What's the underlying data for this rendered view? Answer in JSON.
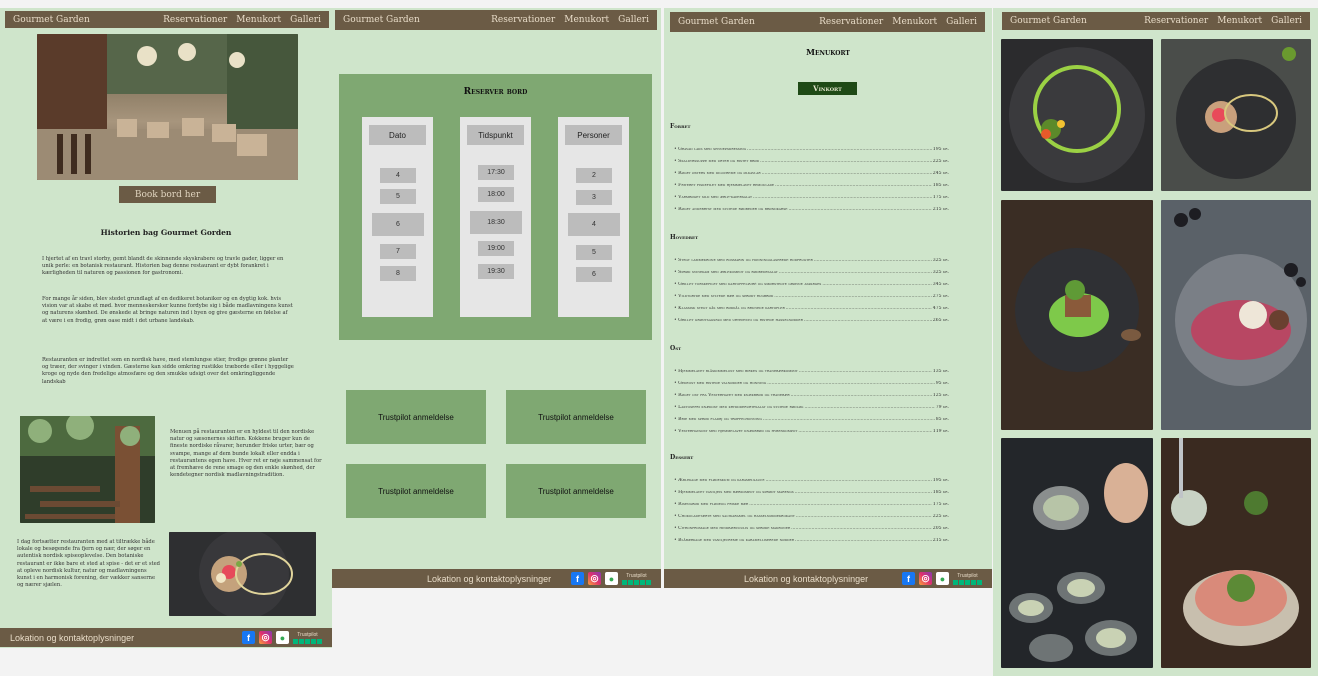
{
  "nav": {
    "brand": "Gourmet Garden",
    "links": [
      "Reservationer",
      "Menukort",
      "Galleri"
    ]
  },
  "home": {
    "book_button": "Book bord her",
    "history_title": "Historien bag Gourmet Gorden",
    "p1": "I hjertet af en travl storby, gemt blandt de skinnende skyskrabere og travle gader, ligger en unik perle: en botanisk restaurant. Historien bag denne restaurant er dybt forankret i kærligheden til naturen og passionen for gastronomi.",
    "p2": "For mange år siden, blev stedet grundlagt af en dedikeret botaniker og en dygtig kok. hvis vision var at skabe et mød. hvor menneskersker kunne fordybe sig i både madlavningens kunst og naturens skønhed. De ønskede at bringe naturen ind i byen og give gæsterne en følelse af at være i en frodig, grøn oase midt i det urbane landskab.",
    "p3": "Restauranten er indrettet som en nordisk have, med stemlungse stier, frodige grønne planter og træer, der svinger i vinden. Gæsterne kan sidde omkring rustikke træborde eller i hyggelige kroge og nyde den fredelige atmosfære og den smukke udsigt over det omkringliggende landskab",
    "p4": "Menuen på restauranten er en hyldest til den nordiske natur og sæsonernes skiften. Kokkene bruger kun de fineste nordiske råvarer, herunder friske urter, bær og svampe, mange af dem bunde lokalt eller endda i restaurantens egen have. Hver ret er nøje sammensat for at fremhæve de rene smage og den enkle skønhed, der kendetegner nordisk madlavningstradition.",
    "p5": "I dag fortsætter restauranten med at tiltrække både lokale og besøgende fra fjern og nær, der søger en autentisk nordisk spiseoplevelse. Den botaniske restaurant er ikke bare et sted at spise - det er et sted at opleve nordisk kultur, natur og madlavningens kunst i en harmonisk forening, der vækker sanserne og nærer sjælen."
  },
  "footer": {
    "label": "Lokation og kontaktoplysninger",
    "trustpilot": "Trustpilot"
  },
  "reserve": {
    "title": "Reserver bord",
    "columns": [
      {
        "header": "Dato",
        "options": [
          "4",
          "5",
          "6",
          "7",
          "8"
        ]
      },
      {
        "header": "Tidspunkt",
        "options": [
          "17:30",
          "18:00",
          "18:30",
          "19:00",
          "19:30"
        ]
      },
      {
        "header": "Personer",
        "options": [
          "2",
          "3",
          "4",
          "5",
          "6"
        ]
      }
    ],
    "trustpilot_boxes": [
      "Trustpilot anmeldelse",
      "Trustpilot anmeldelse",
      "Trustpilot anmeldelse",
      "Trustpilot anmeldelse"
    ]
  },
  "menu": {
    "title": "Menukort",
    "wine_button": "Vinkort",
    "sections": [
      {
        "name": "Forret",
        "items": [
          [
            "Gravad laks med sennepsdressing",
            "195 kr."
          ],
          [
            "Skaldyrssuppe med urter og ristet brød",
            "225 kr."
          ],
          [
            "Røget østers med dildcreme og ølkavlar",
            "245 kr."
          ],
          [
            "Friteret fiskefilet med hjemmelavet remoulade",
            "185 kr."
          ],
          [
            "Varmrøget sild med ærle-kapersalat",
            "175 kr."
          ],
          [
            "Røget andebryst med syltede rødbeder og brøndkarse",
            "215 kr."
          ]
        ]
      },
      {
        "name": "Hovedret",
        "items": [
          [
            "Stegt lammekrone med rosmarin og honningglaserede rodfrugter",
            "325 kr."
          ],
          [
            "Sprød svinekam med æblekompot og rødbedesalat",
            "325 kr."
          ],
          [
            "Grillet torskefilet med kartoffelpuré og smørstegte grønne asparges",
            "345 kr."
          ],
          [
            "Vildtgryde med syltede bær og sprødt rugbrød",
            "275 kr."
          ],
          [
            "Klassisk stegt gås med rødkål og brunede kartofler",
            "475 kr."
          ],
          [
            "Grillet grøntsagsfad med urtepesto og ristede hasselnødder",
            "265 kr."
          ]
        ]
      },
      {
        "name": "Ost",
        "items": [
          [
            "Hjemmelavet blåskimmelost med birkes og tranebærkompot",
            "135 kr."
          ],
          [
            "Gedeost med ristede valnødder og honning",
            "95 kr."
          ],
          [
            "Røget ost fra Vesterhavet med knækbrød og tranebær",
            "125 kr."
          ],
          [
            "Laktosefri knækost med kryddderurtesalat og syltede rødløg",
            "79 kr."
          ],
          [
            "Brie med sprød fladbj og trøffelhonning",
            "85 kr."
          ],
          [
            "Vesterhavsost med hjemmelavet knækbrød og hybenkompot",
            "119 kr."
          ]
        ]
      },
      {
        "name": "Dessert",
        "items": [
          [
            "Æblekage med flødeskum og karamelsauce",
            "195 kr."
          ],
          [
            "Hjemmelavet vaniljeis med bærkompot og sprødt marengs",
            "185 kr."
          ],
          [
            "Risengrød med flødeog friske bær",
            "175 kr."
          ],
          [
            "Chokoladetærte med saltkaramel og hasselnøddekrokant",
            "225 kr."
          ],
          [
            "Citronfromage med hindbærcoulis og sprøde makroner",
            "205 kr."
          ],
          [
            "Blåbærkage med vaniljecreme og karamelliserede nødder",
            "215 kr."
          ]
        ]
      }
    ]
  }
}
